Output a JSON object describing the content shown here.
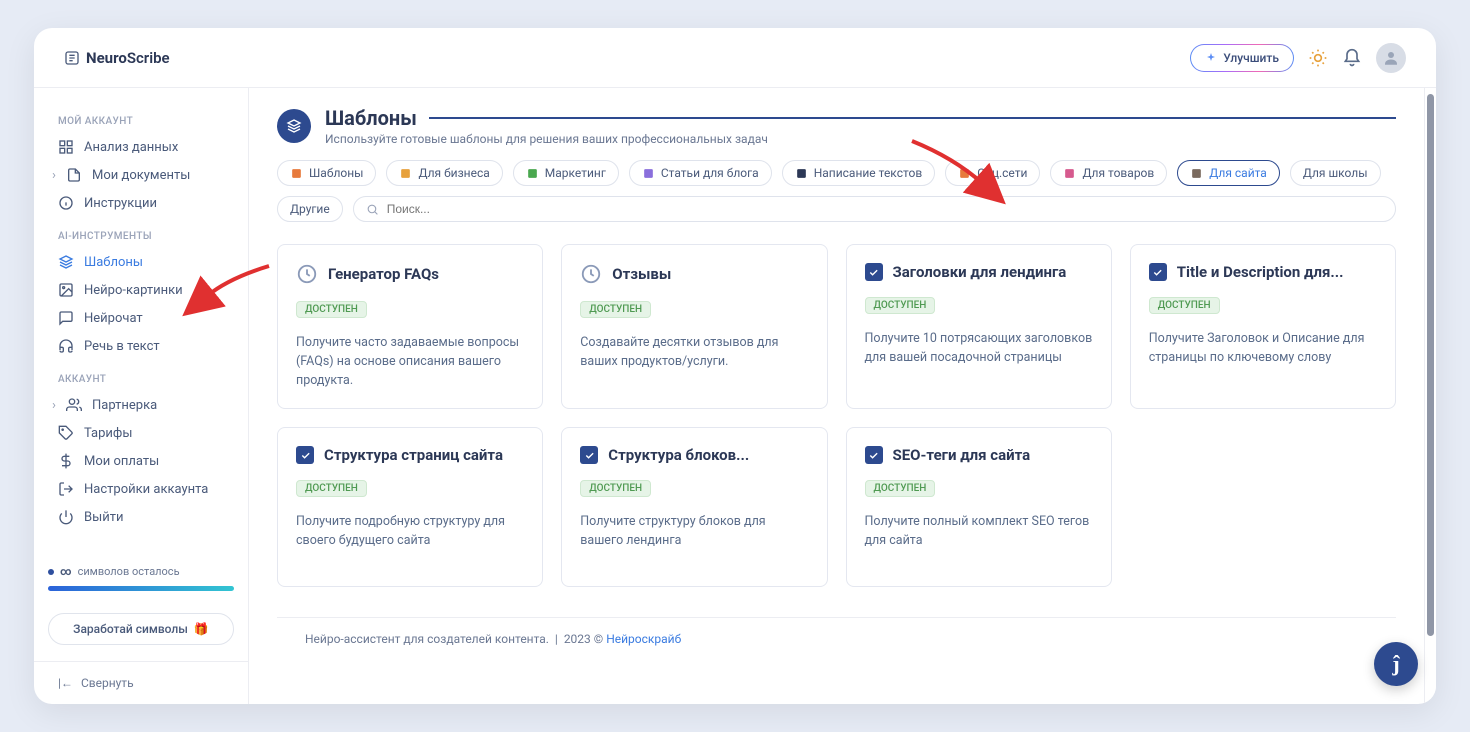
{
  "logo": {
    "prefix": "Neuro",
    "suffix": "Scribe"
  },
  "header": {
    "upgrade_label": "Улучшить"
  },
  "sidebar": {
    "sections": [
      {
        "label": "МОЙ АККАУНТ",
        "items": [
          {
            "label": "Анализ данных",
            "icon": "dashboard-icon"
          },
          {
            "label": "Мои документы",
            "icon": "document-icon",
            "chev": true
          },
          {
            "label": "Инструкции",
            "icon": "info-icon"
          }
        ]
      },
      {
        "label": "AI-ИНСТРУМЕНТЫ",
        "items": [
          {
            "label": "Шаблоны",
            "icon": "layers-icon",
            "active": true
          },
          {
            "label": "Нейро-картинки",
            "icon": "image-icon"
          },
          {
            "label": "Нейрочат",
            "icon": "chat-icon"
          },
          {
            "label": "Речь в текст",
            "icon": "headphones-icon"
          }
        ]
      },
      {
        "label": "АККАУНТ",
        "items": [
          {
            "label": "Партнерка",
            "icon": "users-icon",
            "chev": true
          },
          {
            "label": "Тарифы",
            "icon": "tag-icon"
          },
          {
            "label": "Мои оплаты",
            "icon": "dollar-icon"
          },
          {
            "label": "Настройки аккаунта",
            "icon": "logout-icon"
          },
          {
            "label": "Выйти",
            "icon": "power-icon"
          }
        ]
      }
    ],
    "usage": {
      "symbol": "∞",
      "text": "символов осталось"
    },
    "earn_label": "Заработай символы",
    "collapse_label": "Свернуть"
  },
  "page": {
    "title": "Шаблоны",
    "subtitle": "Используйте готовые шаблоны для решения ваших профессиональных задач"
  },
  "filters": [
    {
      "label": "Шаблоны",
      "icon_color": "#e77a3c"
    },
    {
      "label": "Для бизнеса",
      "icon_color": "#e7a13c"
    },
    {
      "label": "Маркетинг",
      "icon_color": "#4aa74f"
    },
    {
      "label": "Статьи для блога",
      "icon_color": "#8a6fdc"
    },
    {
      "label": "Написание текстов",
      "icon_color": "#2c3856"
    },
    {
      "label": "Соц.сети",
      "icon_color": "#e77a3c"
    },
    {
      "label": "Для товаров",
      "icon_color": "#d65a8e"
    },
    {
      "label": "Для сайта",
      "icon_color": "#7a6a5e",
      "active": true
    },
    {
      "label": "Для школы"
    },
    {
      "label": "Другие"
    }
  ],
  "search": {
    "placeholder": "Поиск..."
  },
  "badge_label": "ДОСТУПЕН",
  "cards": [
    {
      "icon": "clock",
      "title": "Генератор FAQs",
      "desc": "Получите часто задаваемые вопросы (FAQs) на основе описания вашего продукта."
    },
    {
      "icon": "clock",
      "title": "Отзывы",
      "desc": "Создавайте десятки отзывов для ваших продуктов/услуги."
    },
    {
      "icon": "check",
      "title": "Заголовки для лендинга",
      "desc": "Получите 10 потрясающих заголовков для вашей посадочной страницы"
    },
    {
      "icon": "check",
      "title": "Title и Description для...",
      "desc": "Получите Заголовок и Описание для страницы по ключевому слову"
    },
    {
      "icon": "check",
      "title": "Структура страниц сайта",
      "desc": "Получите подробную структуру для своего будущего сайта"
    },
    {
      "icon": "check",
      "title": "Структура блоков...",
      "desc": "Получите структуру блоков для вашего лендинга"
    },
    {
      "icon": "check",
      "title": "SEO-теги для сайта",
      "desc": "Получите полный комплект SEO тегов для сайта"
    }
  ],
  "footer": {
    "tagline": "Нейро-ассистент для создателей контента.",
    "year_prefix": "2023 ©",
    "brand": "Нейроскрайб"
  },
  "fab": "ĵ"
}
